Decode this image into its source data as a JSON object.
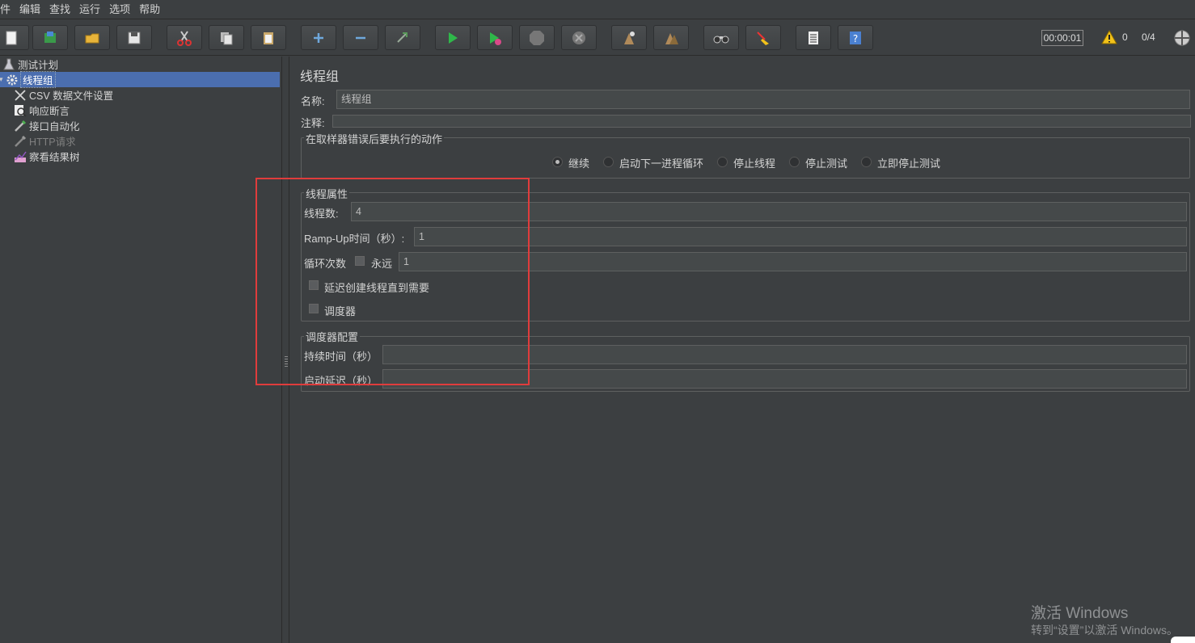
{
  "menubar": {
    "items": [
      "件",
      "编辑",
      "查找",
      "运行",
      "选项",
      "帮助"
    ]
  },
  "toolbar": {
    "icons": [
      "new-icon",
      "templates-icon",
      "open-icon",
      "save-icon",
      "cut-icon",
      "copy-icon",
      "paste-icon",
      "expand-icon",
      "collapse-icon",
      "toggle-icon",
      "start-icon",
      "start-no-pauses-icon",
      "stop-icon",
      "shutdown-icon",
      "clear-icon",
      "clear-all-icon",
      "search-icon",
      "reset-search-icon",
      "function-helper-icon",
      "help-icon"
    ],
    "timer": "00:00:01",
    "warning_count": "0",
    "threads": "0/4"
  },
  "tree": {
    "items": [
      {
        "label": "测试计划",
        "icon": "test-plan-icon"
      },
      {
        "label": "线程组",
        "icon": "gear-icon",
        "selected": true
      },
      {
        "label": "CSV 数据文件设置",
        "icon": "tools-icon"
      },
      {
        "label": "响应断言",
        "icon": "magnifier-icon"
      },
      {
        "label": "接口自动化",
        "icon": "pipette-icon"
      },
      {
        "label": "HTTP请求",
        "icon": "pipette-icon",
        "disabled": true
      },
      {
        "label": "察看结果树",
        "icon": "chart-icon"
      }
    ]
  },
  "panel": {
    "title": "线程组",
    "name_label": "名称:",
    "name_value": "线程组",
    "comment_label": "注释:",
    "comment_value": "",
    "on_error": {
      "legend": "在取样器错误后要执行的动作",
      "options": [
        "继续",
        "启动下一进程循环",
        "停止线程",
        "停止测试",
        "立即停止测试"
      ],
      "selected": "继续"
    },
    "thread_props": {
      "legend": "线程属性",
      "threads_label": "线程数:",
      "threads_value": "4",
      "rampup_label": "Ramp-Up时间（秒）:",
      "rampup_value": "1",
      "loop_label": "循环次数",
      "forever_label": "永远",
      "loop_value": "1",
      "delay_label": "延迟创建线程直到需要",
      "scheduler_label": "调度器"
    },
    "scheduler": {
      "legend": "调度器配置",
      "duration_label": "持续时间（秒）",
      "duration_value": "",
      "delay_label": "启动延迟（秒）",
      "delay_value": ""
    }
  },
  "watermark": {
    "line1": "激活 Windows",
    "line2": "转到“设置”以激活 Windows。"
  },
  "colors": {
    "background": "#3c3f41",
    "selection": "#4b6eaf",
    "highlight_box": "#e03c3c"
  }
}
